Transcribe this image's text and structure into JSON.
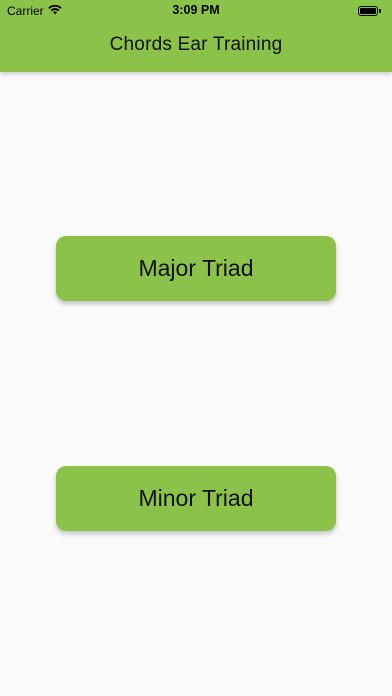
{
  "status_bar": {
    "carrier": "Carrier",
    "time": "3:09 PM",
    "wifi_icon": "wifi-icon",
    "battery_icon": "battery-icon"
  },
  "app_bar": {
    "title": "Chords Ear Training",
    "color": "#8bc34a"
  },
  "main": {
    "buttons": [
      {
        "label": "Major Triad"
      },
      {
        "label": "Minor Triad"
      }
    ],
    "button_color": "#8bc34a",
    "background": "#fafafa"
  }
}
